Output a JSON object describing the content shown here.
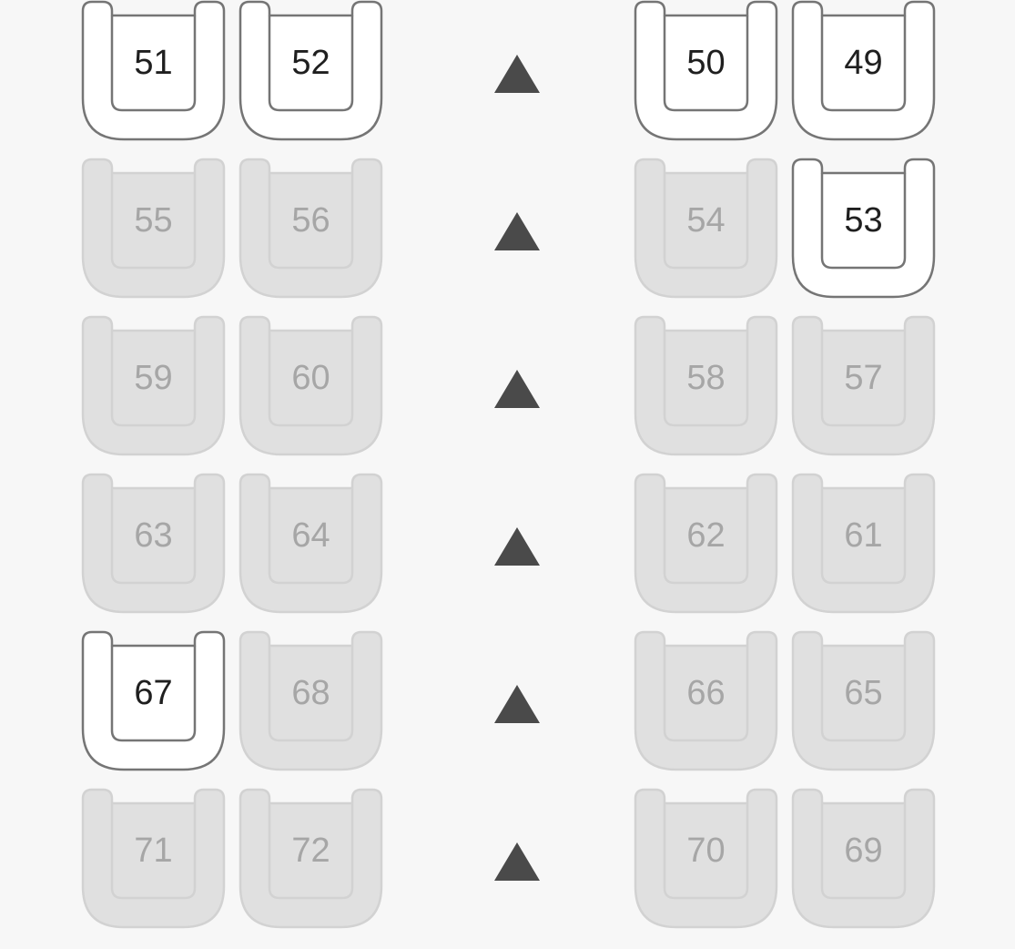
{
  "seat_map": {
    "colors": {
      "available_fill": "#ffffff",
      "available_stroke": "#757575",
      "unavailable_fill": "#e0e0e0",
      "unavailable_stroke": "#d2d2d2",
      "aisle_marker": "#4a4a4a",
      "background": "#f7f7f7"
    },
    "aisle_icon": "triangle-up-icon",
    "rows": [
      {
        "seats": [
          {
            "number": "51",
            "available": true
          },
          {
            "number": "52",
            "available": true
          },
          {
            "number": "50",
            "available": true
          },
          {
            "number": "49",
            "available": true
          }
        ]
      },
      {
        "seats": [
          {
            "number": "55",
            "available": false
          },
          {
            "number": "56",
            "available": false
          },
          {
            "number": "54",
            "available": false
          },
          {
            "number": "53",
            "available": true
          }
        ]
      },
      {
        "seats": [
          {
            "number": "59",
            "available": false
          },
          {
            "number": "60",
            "available": false
          },
          {
            "number": "58",
            "available": false
          },
          {
            "number": "57",
            "available": false
          }
        ]
      },
      {
        "seats": [
          {
            "number": "63",
            "available": false
          },
          {
            "number": "64",
            "available": false
          },
          {
            "number": "62",
            "available": false
          },
          {
            "number": "61",
            "available": false
          }
        ]
      },
      {
        "seats": [
          {
            "number": "67",
            "available": true
          },
          {
            "number": "68",
            "available": false
          },
          {
            "number": "66",
            "available": false
          },
          {
            "number": "65",
            "available": false
          }
        ]
      },
      {
        "seats": [
          {
            "number": "71",
            "available": false
          },
          {
            "number": "72",
            "available": false
          },
          {
            "number": "70",
            "available": false
          },
          {
            "number": "69",
            "available": false
          }
        ]
      }
    ]
  }
}
